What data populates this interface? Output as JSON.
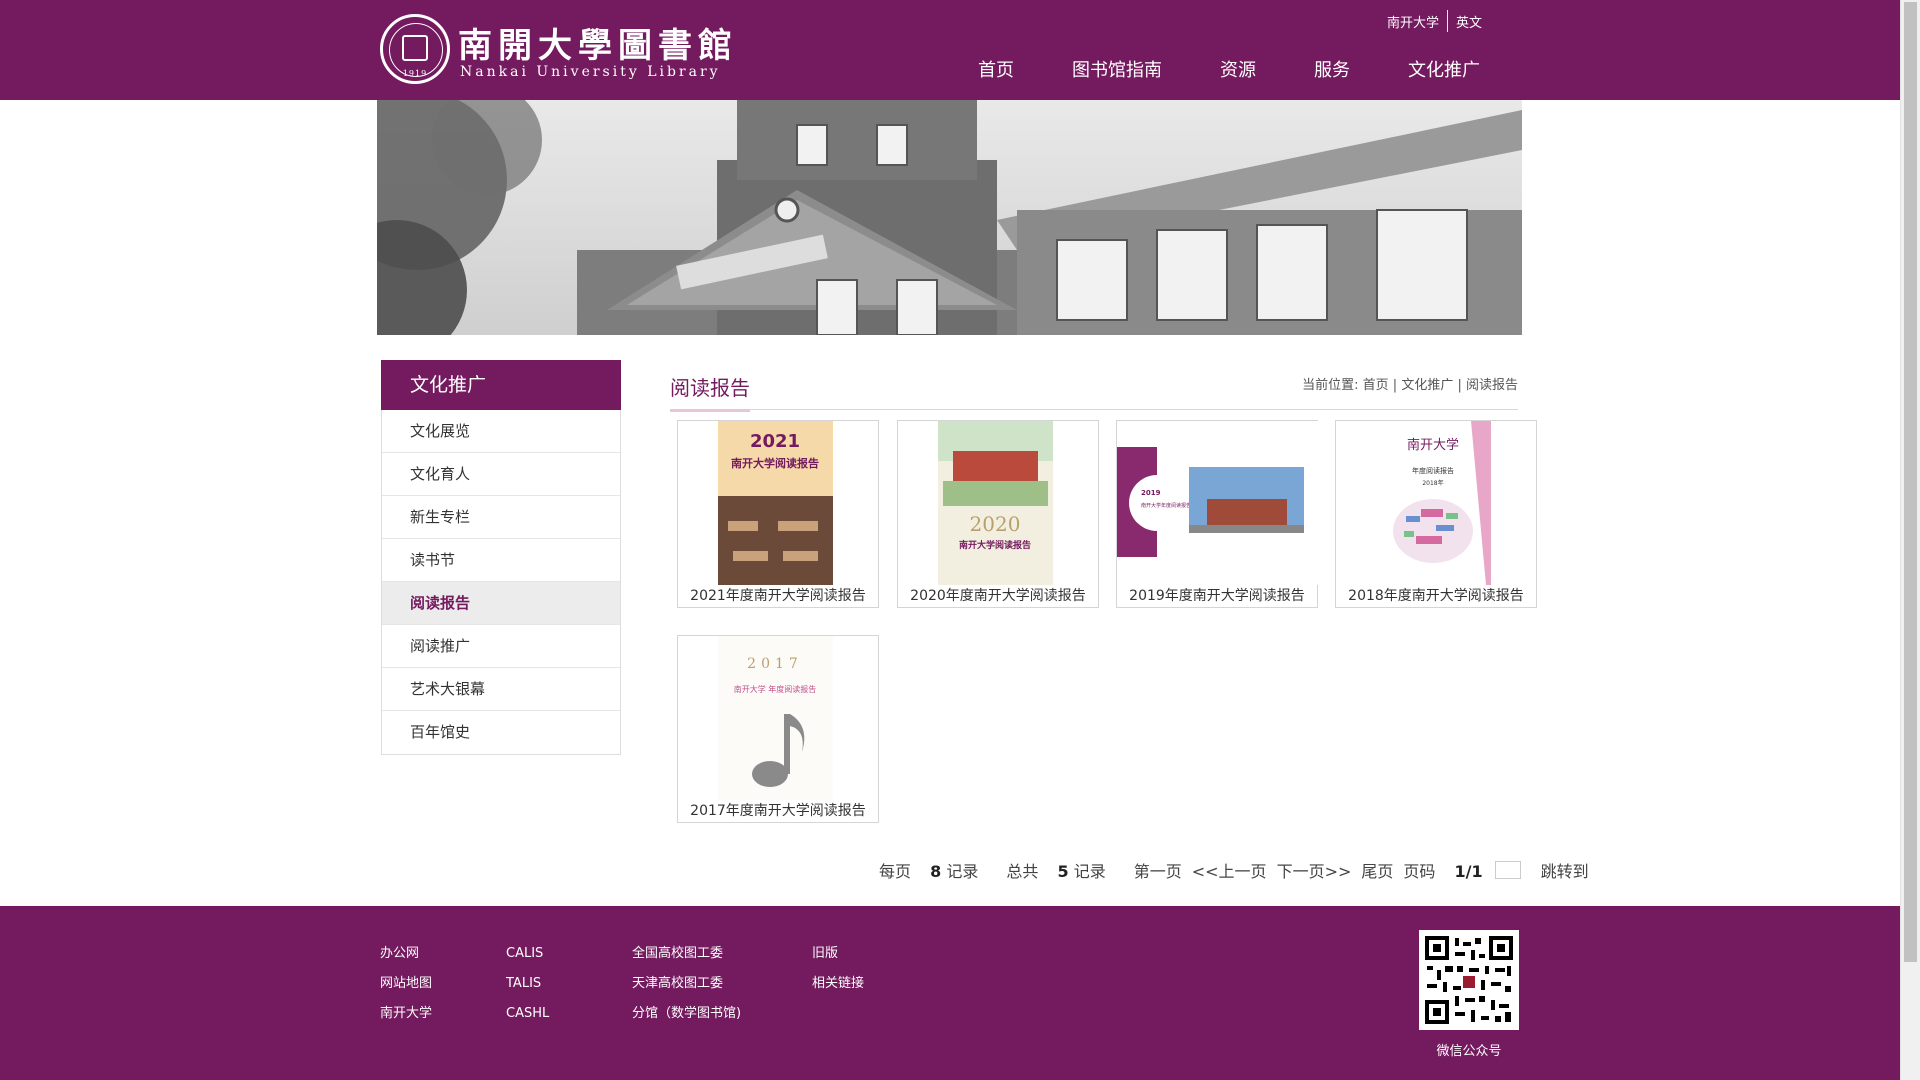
{
  "header": {
    "logo_cn": "南開大學圖書館",
    "logo_en": "Nankai University Library",
    "seal_year": "1919",
    "toplinks": [
      "南开大学",
      "英文"
    ],
    "nav": [
      "首页",
      "图书馆指南",
      "资源",
      "服务",
      "文化推广"
    ]
  },
  "sidebar": {
    "title": "文化推广",
    "items": [
      {
        "label": "文化展览"
      },
      {
        "label": "文化育人"
      },
      {
        "label": "新生专栏"
      },
      {
        "label": "读书节"
      },
      {
        "label": "阅读报告",
        "active": true
      },
      {
        "label": "阅读推广"
      },
      {
        "label": "艺术大银幕"
      },
      {
        "label": "百年馆史"
      }
    ]
  },
  "content": {
    "title": "阅读报告",
    "breadcrumb_label": "当前位置:",
    "breadcrumb": [
      "首页",
      "文化推广",
      "阅读报告"
    ],
    "reports": [
      {
        "caption": "2021年度南开大学阅读报告",
        "cover_year": "2021",
        "cover_title": "南开大学阅读报告"
      },
      {
        "caption": "2020年度南开大学阅读报告",
        "cover_year": "2020",
        "cover_title": "南开大学阅读报告"
      },
      {
        "caption": "2019年度南开大学阅读报告",
        "cover_year": "2019",
        "cover_title": "南开大学年度阅读报告"
      },
      {
        "caption": "2018年度南开大学阅读报告",
        "cover_year": "2018年",
        "cover_title": "年度阅读报告",
        "cover_brand": "南开大学"
      },
      {
        "caption": "2017年度南开大学阅读报告",
        "cover_year": "2017",
        "cover_title": "南开大学 年度阅读报告"
      }
    ]
  },
  "pager": {
    "per_page_label": "每页",
    "per_page": "8",
    "records_label": "记录",
    "total_label": "总共",
    "total": "5",
    "first": "第一页",
    "prev": "<<上一页",
    "next": "下一页>>",
    "last": "尾页",
    "page_label": "页码",
    "page": "1/1",
    "jump": "跳转到"
  },
  "footer": {
    "col1": [
      "办公网",
      "网站地图",
      "南开大学"
    ],
    "col2": [
      "CALIS",
      "TALIS",
      "CASHL"
    ],
    "col3": [
      "全国高校图工委",
      "天津高校图工委",
      "分馆（数学图书馆)"
    ],
    "col4": [
      "旧版",
      "相关链接"
    ],
    "qr_label": "微信公众号"
  },
  "colors": {
    "brand": "#741a5e",
    "accent_light": "#e7c6da"
  }
}
